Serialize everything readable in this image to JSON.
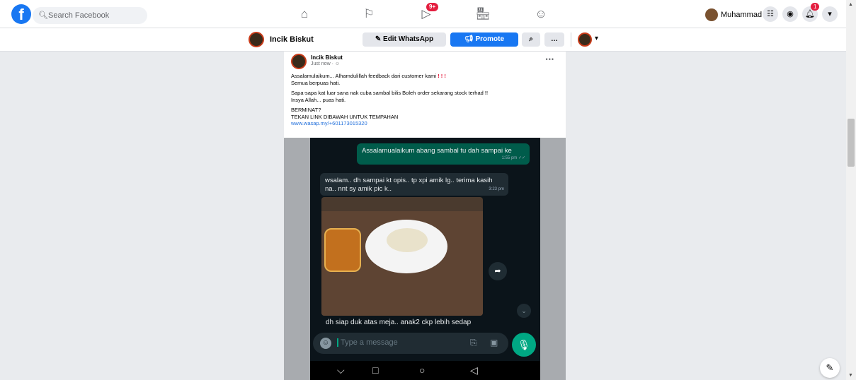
{
  "topbar": {
    "search_placeholder": "Search Facebook",
    "video_badge": "9+",
    "profile_name": "Muhammad",
    "notif_badge": "1"
  },
  "pagebar": {
    "page_name": "Incik Biskut",
    "edit_whatsapp": "Edit WhatsApp",
    "promote": "Promote"
  },
  "post": {
    "author": "Incik Biskut",
    "time": "Just now · ☺",
    "p1_line1": "Assalamulaikum... Alhamdulillah feedback dari customer kami",
    "p1_excl": "! ! !",
    "p1_line2": "Semua  berpuas hati.",
    "p2_line1": "Sapa-sapa kat luar sana nak cuba sambal bilis   Boleh order sekarang stock terhad !!",
    "p2_line2": "Insya Allah... puas hati.",
    "p3_line1": "BERMINAT?",
    "p3_line2": "TEKAN LINK DIBAWAH UNTUK TEMPAHAN",
    "link": "www.wasap.my/+601173015320"
  },
  "chat": {
    "msg_out": "Assalamualaikum abang sambal tu dah  sampai ke",
    "msg_out_time": "1:55 pm ✓✓",
    "msg_in": "wsalam.. dh sampai kt opis.. tp xpi amik lg.. terima kasih na.. nnt sy amik pic k..",
    "msg_in_time": "3:23 pm",
    "caption": "dh siap duk atas meja.. anak2 ckp lebih sedap",
    "input_placeholder": "Type a message"
  },
  "colors": {
    "facebook_blue": "#1877f2",
    "whatsapp_green": "#00a884",
    "badge_red": "#e41e3f"
  }
}
